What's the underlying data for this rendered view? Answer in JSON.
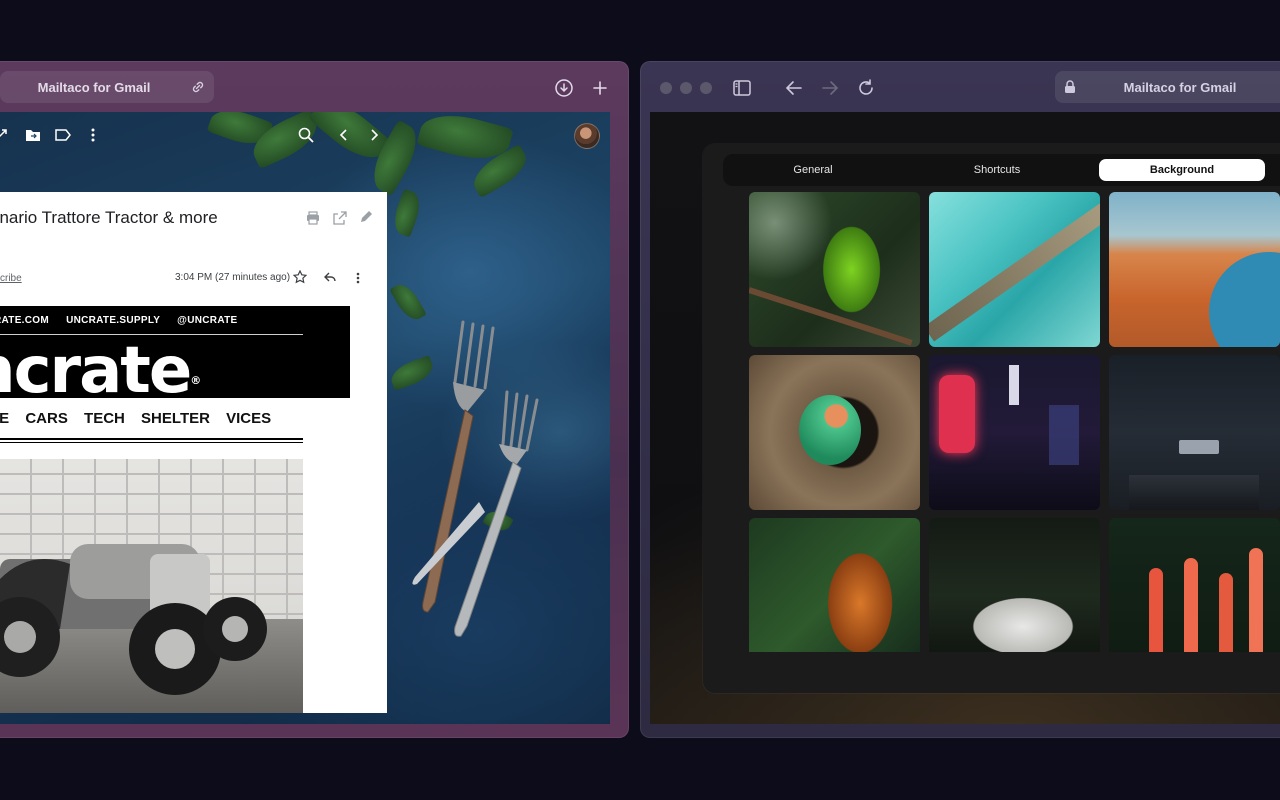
{
  "left_window": {
    "url_title": "Mailtaco for Gmail",
    "gmail": {
      "email": {
        "subject": "enario Trattore Tractor & more",
        "sender_link": "cribe",
        "time": "3:04 PM (27 minutes ago)",
        "banner_links": "RATE.COM UNCRATE.SUPPLY @UNCRATE",
        "logo_text": "ncrate",
        "logo_mark": "®",
        "nav_items": [
          "LE",
          "CARS",
          "TECH",
          "SHELTER",
          "VICES"
        ]
      }
    }
  },
  "right_window": {
    "url_title": "Mailtaco for Gmail",
    "settings": {
      "tabs": [
        {
          "label": "General",
          "active": false
        },
        {
          "label": "Shortcuts",
          "active": false
        },
        {
          "label": "Background",
          "active": true
        }
      ],
      "backgrounds": [
        {
          "name": "parakeet"
        },
        {
          "name": "turquoise-aerial"
        },
        {
          "name": "desert-coast"
        },
        {
          "name": "lovebird"
        },
        {
          "name": "neon-alley"
        },
        {
          "name": "dark-street"
        },
        {
          "name": "tiger"
        },
        {
          "name": "white-tiger"
        },
        {
          "name": "flamingos"
        }
      ]
    }
  },
  "colors": {
    "desktop": "#0d0c1a",
    "left_chrome": "#5c3a5e",
    "right_chrome": "#3a3552",
    "active_tab": "#ffffff"
  }
}
